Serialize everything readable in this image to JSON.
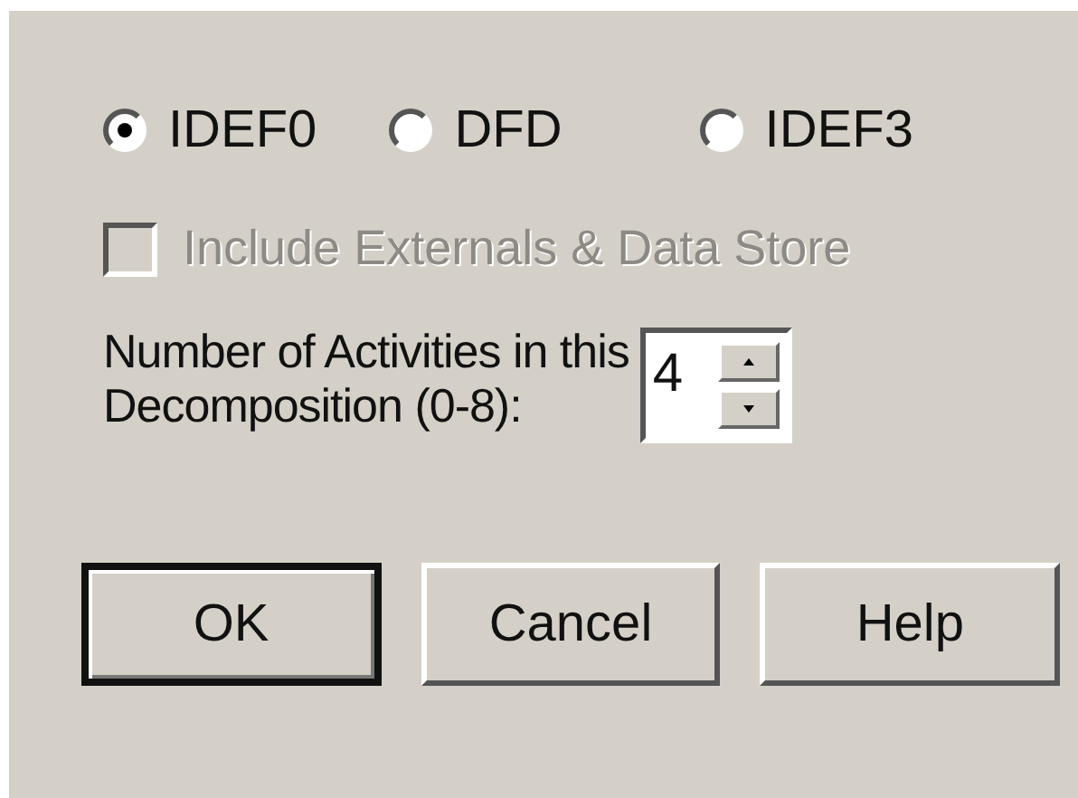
{
  "methods": [
    {
      "label": "IDEF0",
      "selected": true
    },
    {
      "label": "DFD",
      "selected": false
    },
    {
      "label": "IDEF3",
      "selected": false
    }
  ],
  "include_option": {
    "label": "Include Externals & Data Store",
    "checked": false,
    "disabled": true
  },
  "activities": {
    "label_lines": [
      "Number of Activities in this",
      "Decomposition (0-8):"
    ],
    "value": "4"
  },
  "buttons": [
    {
      "label": "OK",
      "default": true
    },
    {
      "label": "Cancel",
      "default": false
    },
    {
      "label": "Help",
      "default": false
    }
  ]
}
